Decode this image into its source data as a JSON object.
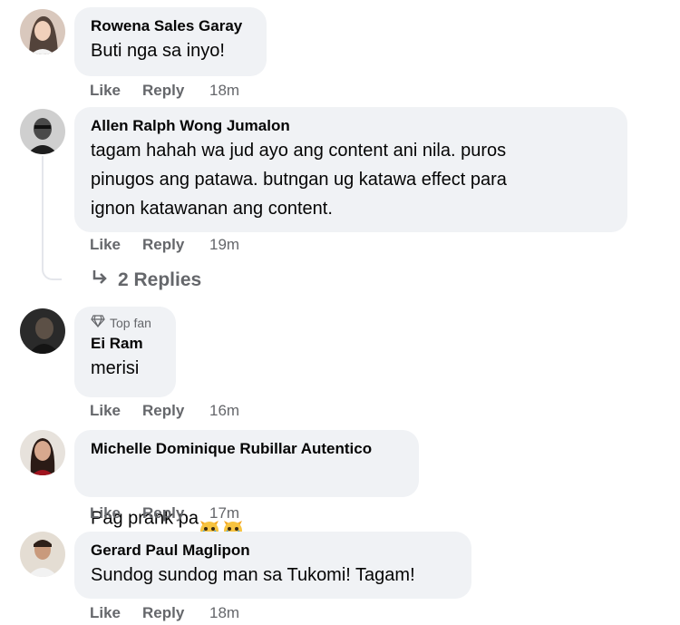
{
  "comments": [
    {
      "author": "Rowena Sales Garay",
      "text": "Buti nga sa inyo!",
      "like": "Like",
      "reply": "Reply",
      "time": "18m"
    },
    {
      "author": "Allen Ralph Wong Jumalon",
      "text": "tagam hahah wa jud ayo ang content ani nila. puros\npinugos ang patawa. butngan ug katawa effect para\nignon katawanan ang content.",
      "like": "Like",
      "reply": "Reply",
      "time": "19m",
      "replies_label": "2 Replies"
    },
    {
      "badge": "Top fan",
      "author": "Ei Ram",
      "text": "merisi",
      "like": "Like",
      "reply": "Reply",
      "time": "16m"
    },
    {
      "author": "Michelle Dominique Rubillar Autentico",
      "text": "Pag prank pa",
      "emoji": "crying-cat-face-emoji",
      "like": "Like",
      "reply": "Reply",
      "time": "17m"
    },
    {
      "author": "Gerard Paul Maglipon",
      "text": "Sundog sundog man sa Tukomi! Tagam!",
      "like": "Like",
      "reply": "Reply",
      "time": "18m"
    }
  ],
  "colors": {
    "bubble": "#f0f2f5",
    "meta": "#65676b",
    "text": "#050505"
  }
}
